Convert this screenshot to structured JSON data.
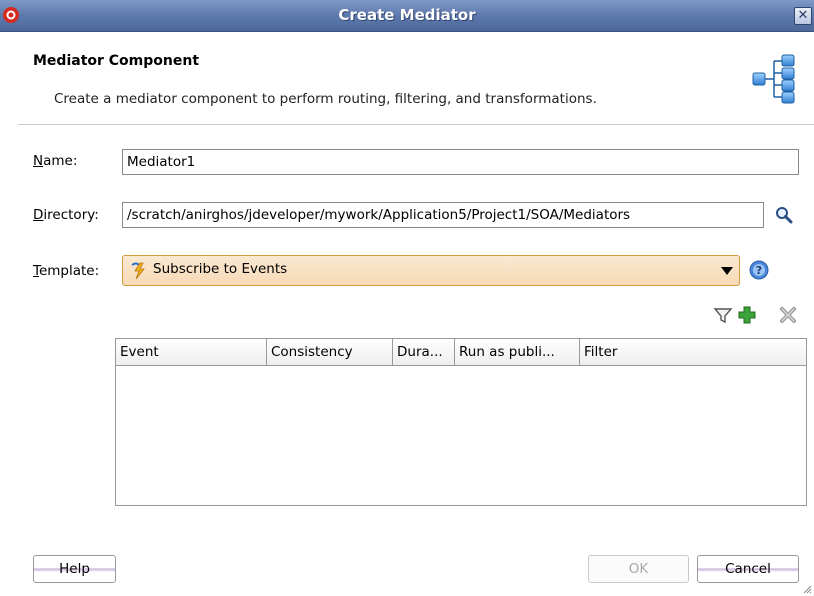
{
  "window": {
    "title": "Create Mediator",
    "close_glyph": "✕"
  },
  "header": {
    "title": "Mediator Component",
    "description": "Create a mediator component to perform routing, filtering, and transformations.",
    "icon": "mediator-component-icon"
  },
  "form": {
    "name": {
      "label_mnemonic": "N",
      "label_rest": "ame:",
      "value": "Mediator1"
    },
    "directory": {
      "label_mnemonic": "D",
      "label_rest": "irectory:",
      "value": "/scratch/anirghos/jdeveloper/mywork/Application5/Project1/SOA/Mediators"
    },
    "template": {
      "label_mnemonic": "T",
      "label_rest": "emplate:",
      "selected": "Subscribe to Events"
    }
  },
  "toolbar": {
    "icons": [
      "filter-icon",
      "add-icon",
      "delete-icon"
    ]
  },
  "events_table": {
    "columns": [
      "Event",
      "Consistency",
      "Dura...",
      "Run as publi...",
      "Filter"
    ],
    "rows": []
  },
  "buttons": {
    "help": "Help",
    "ok": "OK",
    "cancel": "Cancel"
  },
  "colors": {
    "titlebar": "#5e79ad",
    "template_select_bg": "#f7d9b6",
    "template_select_border": "#d39a44",
    "add_green": "#3aa33a",
    "button_accent": "#c9b6d9"
  }
}
